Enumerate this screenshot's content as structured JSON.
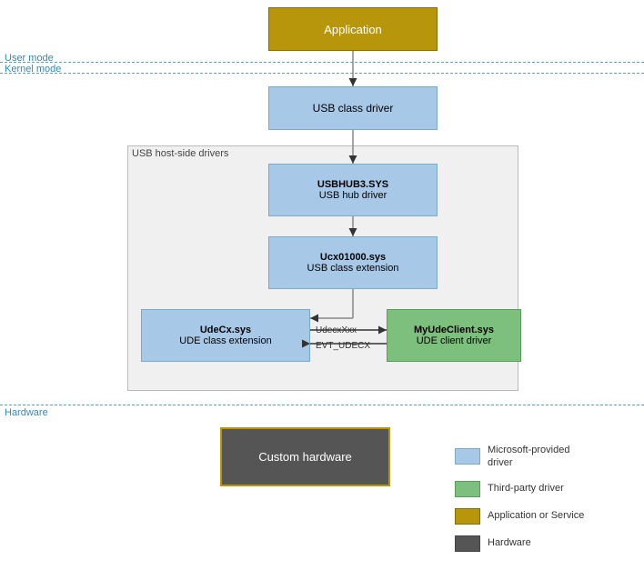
{
  "diagram": {
    "app_label": "Application",
    "user_mode_label": "User mode",
    "kernel_mode_label": "Kernel mode",
    "usb_class_driver_label": "USB class driver",
    "usb_host_container_label": "USB host-side drivers",
    "usbhub_title": "USBHUB3.SYS",
    "usbhub_subtitle": "USB hub driver",
    "ucx_title": "Ucx01000.sys",
    "ucx_subtitle": "USB class extension",
    "udecx_title": "UdeCx.sys",
    "udecx_subtitle": "UDE class extension",
    "myude_title": "MyUdeClient.sys",
    "myude_subtitle": "UDE client driver",
    "arrow_top_label": "UdecxXxx",
    "arrow_bottom_label": "EVT_UDECX",
    "hardware_label": "Hardware",
    "custom_hw_label": "Custom hardware",
    "legend": {
      "blue_label": "Microsoft-provided\ndriver",
      "green_label": "Third-party driver",
      "gold_label": "Application or Service",
      "dark_label": "Hardware"
    }
  }
}
